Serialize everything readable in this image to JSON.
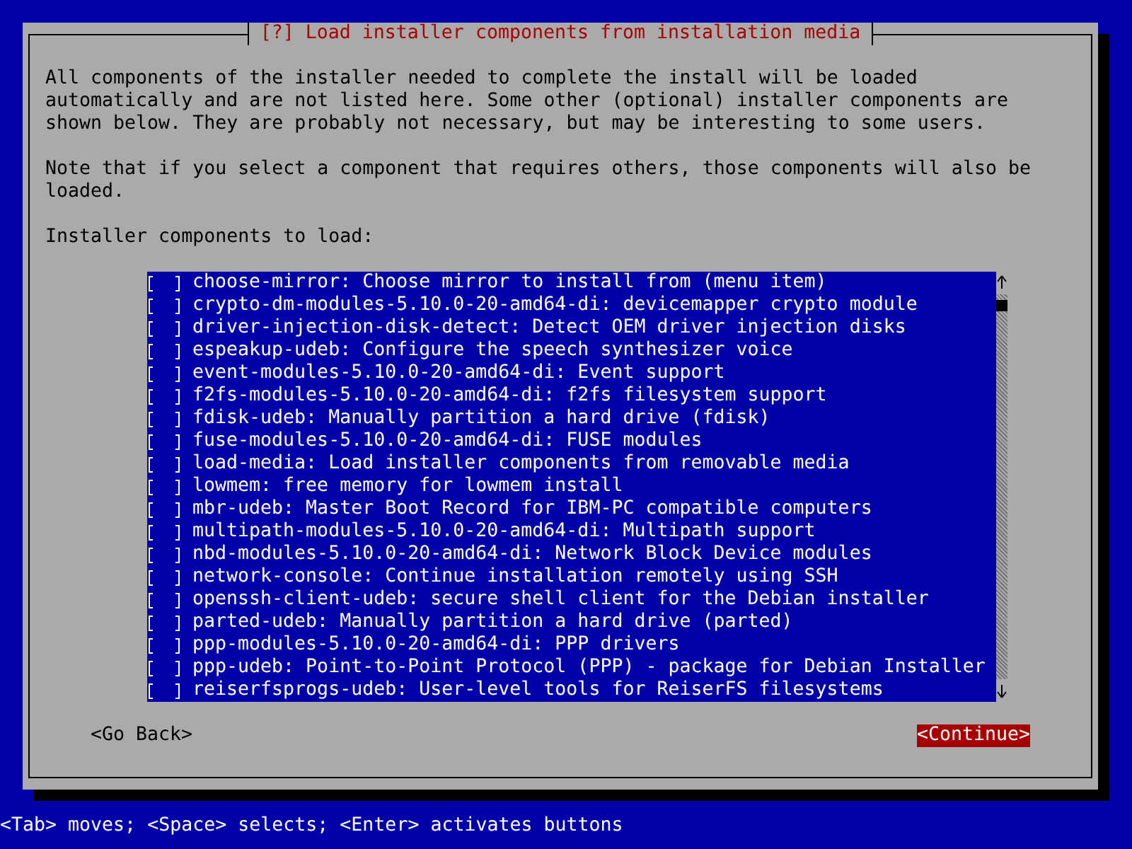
{
  "dialog": {
    "title": "[?] Load installer components from installation media",
    "description": "All components of the installer needed to complete the install will be loaded\nautomatically and are not listed here. Some other (optional) installer components are\nshown below. They are probably not necessary, but may be interesting to some users.",
    "note": "Note that if you select a component that requires others, those components will also be\nloaded.",
    "list_label": "Installer components to load:",
    "components": [
      {
        "label": "choose-mirror: Choose mirror to install from (menu item)",
        "checked": false
      },
      {
        "label": "crypto-dm-modules-5.10.0-20-amd64-di: devicemapper crypto module",
        "checked": false
      },
      {
        "label": "driver-injection-disk-detect: Detect OEM driver injection disks",
        "checked": false
      },
      {
        "label": "espeakup-udeb: Configure the speech synthesizer voice",
        "checked": false
      },
      {
        "label": "event-modules-5.10.0-20-amd64-di: Event support",
        "checked": false
      },
      {
        "label": "f2fs-modules-5.10.0-20-amd64-di: f2fs filesystem support",
        "checked": false
      },
      {
        "label": "fdisk-udeb: Manually partition a hard drive (fdisk)",
        "checked": false
      },
      {
        "label": "fuse-modules-5.10.0-20-amd64-di: FUSE modules",
        "checked": false
      },
      {
        "label": "load-media: Load installer components from removable media",
        "checked": false
      },
      {
        "label": "lowmem: free memory for lowmem install",
        "checked": false
      },
      {
        "label": "mbr-udeb: Master Boot Record for IBM-PC compatible computers",
        "checked": false
      },
      {
        "label": "multipath-modules-5.10.0-20-amd64-di: Multipath support",
        "checked": false
      },
      {
        "label": "nbd-modules-5.10.0-20-amd64-di: Network Block Device modules",
        "checked": false
      },
      {
        "label": "network-console: Continue installation remotely using SSH",
        "checked": false
      },
      {
        "label": "openssh-client-udeb: secure shell client for the Debian installer",
        "checked": false
      },
      {
        "label": "parted-udeb: Manually partition a hard drive (parted)",
        "checked": false
      },
      {
        "label": "ppp-modules-5.10.0-20-amd64-di: PPP drivers",
        "checked": false
      },
      {
        "label": "ppp-udeb: Point-to-Point Protocol (PPP) - package for Debian Installer",
        "checked": false
      },
      {
        "label": "reiserfsprogs-udeb: User-level tools for ReiserFS filesystems",
        "checked": false
      }
    ],
    "buttons": [
      {
        "label": "<Go Back>",
        "selected": false
      },
      {
        "label": "<Continue>",
        "selected": true
      }
    ]
  },
  "status_bar": "<Tab> moves; <Space> selects; <Enter> activates buttons"
}
